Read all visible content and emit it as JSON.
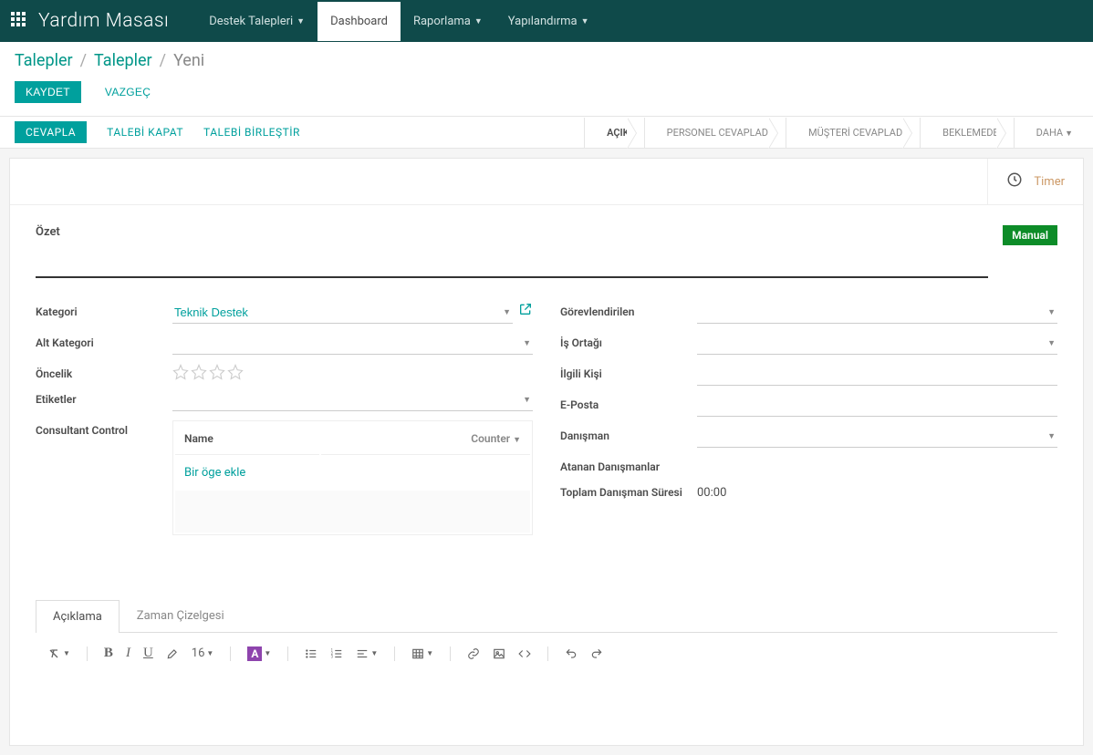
{
  "navbar": {
    "brand": "Yardım Masası",
    "items": [
      {
        "label": "Destek Talepleri",
        "dropdown": true,
        "active": false
      },
      {
        "label": "Dashboard",
        "dropdown": false,
        "active": true
      },
      {
        "label": "Raporlama",
        "dropdown": true,
        "active": false
      },
      {
        "label": "Yapılandırma",
        "dropdown": true,
        "active": false
      }
    ]
  },
  "breadcrumb": {
    "items": [
      "Talepler",
      "Talepler"
    ],
    "current": "Yeni"
  },
  "buttons": {
    "save": "KAYDET",
    "discard": "VAZGEÇ"
  },
  "status_actions": {
    "reply": "CEVAPLA",
    "close": "TALEBİ KAPAT",
    "merge": "TALEBİ BİRLEŞTİR"
  },
  "status_steps": [
    {
      "label": "AÇIK",
      "active": true
    },
    {
      "label": "PERSONEL CEVAPLADI",
      "active": false
    },
    {
      "label": "MÜŞTERİ CEVAPLADI",
      "active": false
    },
    {
      "label": "BEKLEMEDE",
      "active": false
    },
    {
      "label": "DAHA",
      "active": false,
      "dropdown": true
    }
  ],
  "timer": {
    "label": "Timer"
  },
  "form": {
    "summary_label": "Özet",
    "summary_value": "",
    "manual_badge": "Manual",
    "left": {
      "category_label": "Kategori",
      "category_value": "Teknik Destek",
      "subcategory_label": "Alt Kategori",
      "subcategory_value": "",
      "priority_label": "Öncelik",
      "tags_label": "Etiketler",
      "tags_value": "",
      "consultant_control_label": "Consultant Control",
      "cc_table": {
        "col_name": "Name",
        "col_counter": "Counter",
        "add_row": "Bir öge ekle"
      }
    },
    "right": {
      "assigned_label": "Görevlendirilen",
      "assigned_value": "",
      "partner_label": "İş Ortağı",
      "partner_value": "",
      "person_label": "İlgili Kişi",
      "person_value": "",
      "email_label": "E-Posta",
      "email_value": "",
      "advisor_label": "Danışman",
      "advisor_value": "",
      "assigned_advisors_label": "Atanan Danışmanlar",
      "total_time_label": "Toplam Danışman Süresi",
      "total_time_value": "00:00"
    }
  },
  "tabs": [
    {
      "label": "Açıklama",
      "active": true
    },
    {
      "label": "Zaman Çizelgesi",
      "active": false
    }
  ],
  "editor": {
    "font_size": "16",
    "color_letter": "A"
  }
}
